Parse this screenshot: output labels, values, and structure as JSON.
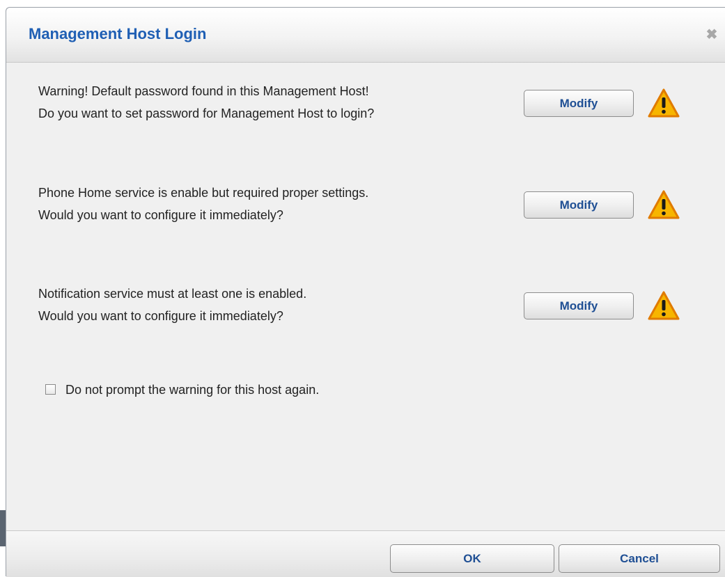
{
  "dialog": {
    "title": "Management Host Login",
    "close_icon": "close-icon"
  },
  "warnings": [
    {
      "line1": "Warning! Default password found in this Management Host!",
      "line2": "Do you want to set password for Management Host to login?",
      "button_label": "Modify",
      "icon": "warning-icon"
    },
    {
      "line1": "Phone Home service is enable but required proper settings.",
      "line2": "Would you want to configure it immediately?",
      "button_label": "Modify",
      "icon": "warning-icon"
    },
    {
      "line1": "Notification service must at least one is enabled.",
      "line2": "Would you want to configure it immediately?",
      "button_label": "Modify",
      "icon": "warning-icon"
    }
  ],
  "checkbox": {
    "label": "Do not prompt the warning for this host again.",
    "checked": false
  },
  "footer": {
    "ok_label": "OK",
    "cancel_label": "Cancel"
  },
  "colors": {
    "title": "#1f5fb4",
    "button_text": "#1f4f94",
    "warning_fill": "#f7b500",
    "warning_border": "#e07b00"
  }
}
